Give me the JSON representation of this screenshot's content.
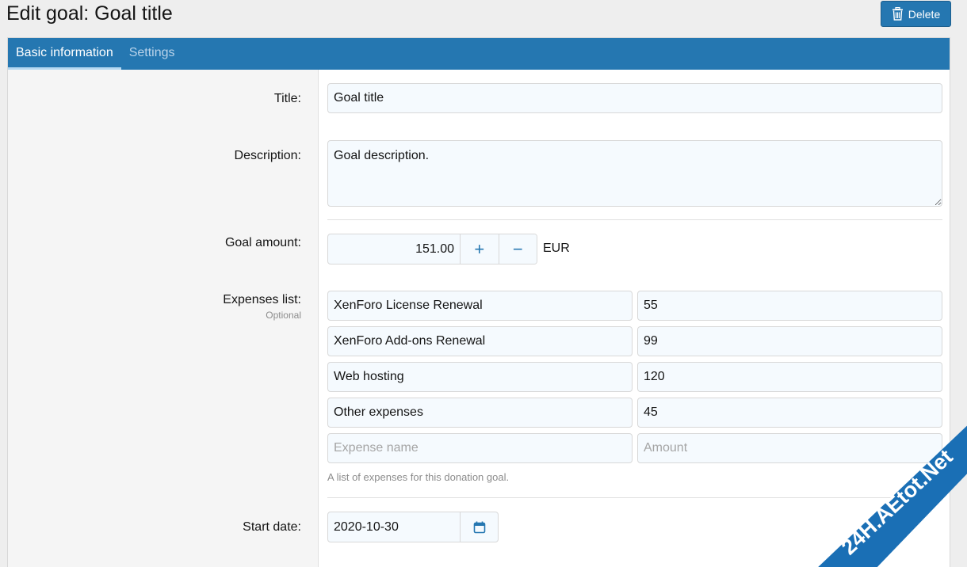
{
  "page": {
    "title": "Edit goal: Goal title"
  },
  "header": {
    "delete_label": "Delete"
  },
  "tabs": [
    {
      "label": "Basic information",
      "active": true
    },
    {
      "label": "Settings",
      "active": false
    }
  ],
  "form": {
    "title": {
      "label": "Title:",
      "value": "Goal title"
    },
    "description": {
      "label": "Description:",
      "value": "Goal description."
    },
    "goal_amount": {
      "label": "Goal amount:",
      "value": "151.00",
      "unit": "EUR",
      "plus": "+",
      "minus": "−"
    },
    "expenses": {
      "label": "Expenses list:",
      "hint": "Optional",
      "items": [
        {
          "name": "XenForo License Renewal",
          "amount": "55"
        },
        {
          "name": "XenForo Add-ons Renewal",
          "amount": "99"
        },
        {
          "name": "Web hosting",
          "amount": "120"
        },
        {
          "name": "Other expenses",
          "amount": "45"
        }
      ],
      "name_placeholder": "Expense name",
      "amount_placeholder": "Amount",
      "explain": "A list of expenses for this donation goal."
    },
    "start_date": {
      "label": "Start date:",
      "value": "2020-10-30"
    }
  },
  "watermark": {
    "text": "24H.AEtot.Net"
  },
  "colors": {
    "accent": "#2577b1",
    "input_bg": "#f5fafe",
    "watermark": "#1a6fb5"
  },
  "icons": {
    "delete": "trash-icon",
    "calendar": "calendar-icon",
    "increment": "plus-icon",
    "decrement": "minus-icon"
  }
}
